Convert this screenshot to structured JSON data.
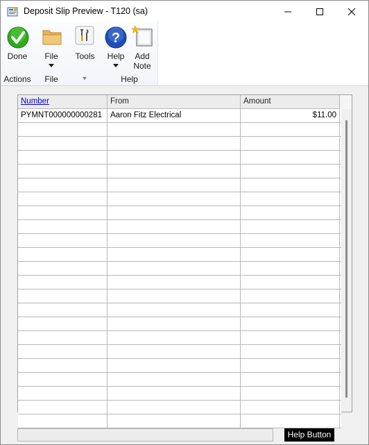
{
  "window": {
    "title": "Deposit Slip Preview  -  T120 (sa)"
  },
  "ribbon": {
    "actions": {
      "done_label": "Done",
      "group_label": "Actions"
    },
    "file": {
      "file_label": "File",
      "group_label": "File"
    },
    "tools": {
      "tools_label": "Tools"
    },
    "help": {
      "help_label": "Help",
      "add_note_label": "Add Note",
      "add_note_line1": "Add",
      "add_note_line2": "Note",
      "group_label": "Help"
    }
  },
  "grid": {
    "columns": [
      "Number",
      "From",
      "Amount"
    ],
    "rows": [
      {
        "number": "PYMNT000000000281",
        "from": "Aaron Fitz Electrical",
        "amount": "$11.00"
      }
    ],
    "empty_rows": 22
  },
  "footer": {
    "help_button_label": "Help Button"
  },
  "colors": {
    "done_green": "#2eaa1f",
    "help_blue": "#1e4fb4",
    "folder": "#e3b25a"
  }
}
